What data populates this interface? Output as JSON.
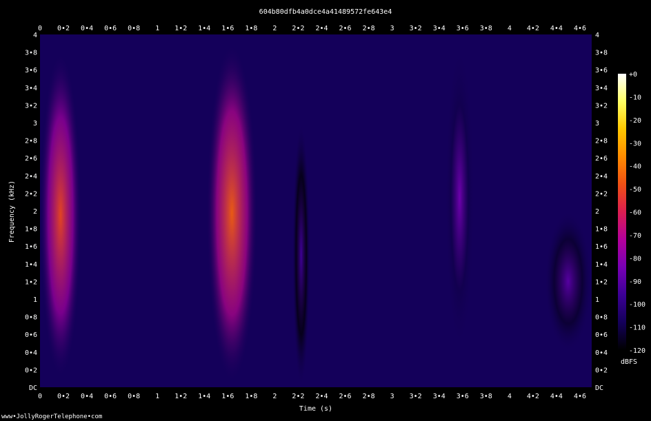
{
  "chart_data": {
    "type": "heatmap",
    "title": "604b80dfb4a0dce4a41489572fe643e4",
    "xlabel": "Time (s)",
    "ylabel": "Frequency (kHz)",
    "xlim": [
      0,
      4.7
    ],
    "ylim": [
      0,
      4
    ],
    "x_ticks": [
      "0",
      "0•2",
      "0•4",
      "0•6",
      "0•8",
      "1",
      "1•2",
      "1•4",
      "1•6",
      "1•8",
      "2",
      "2•2",
      "2•4",
      "2•6",
      "2•8",
      "3",
      "3•2",
      "3•4",
      "3•6",
      "3•8",
      "4",
      "4•2",
      "4•4",
      "4•6"
    ],
    "x_tick_values": [
      0,
      0.2,
      0.4,
      0.6,
      0.8,
      1,
      1.2,
      1.4,
      1.6,
      1.8,
      2,
      2.2,
      2.4,
      2.6,
      2.8,
      3,
      3.2,
      3.4,
      3.6,
      3.8,
      4,
      4.2,
      4.4,
      4.6
    ],
    "y_ticks": [
      "DC",
      "0•2",
      "0•4",
      "0•6",
      "0•8",
      "1",
      "1•2",
      "1•4",
      "1•6",
      "1•8",
      "2",
      "2•2",
      "2•4",
      "2•6",
      "2•8",
      "3",
      "3•2",
      "3•4",
      "3•6",
      "3•8",
      "4"
    ],
    "y_tick_values": [
      0,
      0.2,
      0.4,
      0.6,
      0.8,
      1,
      1.2,
      1.4,
      1.6,
      1.8,
      2,
      2.2,
      2.4,
      2.6,
      2.8,
      3,
      3.2,
      3.4,
      3.6,
      3.8,
      4
    ],
    "colorbar": {
      "label": "dBFS",
      "ticks": [
        "+0",
        "-10",
        "-20",
        "-30",
        "-40",
        "-50",
        "-60",
        "-70",
        "-80",
        "-90",
        "-100",
        "-110",
        "-120"
      ],
      "tick_values": [
        0,
        -10,
        -20,
        -30,
        -40,
        -50,
        -60,
        -70,
        -80,
        -90,
        -100,
        -110,
        -120
      ],
      "range": [
        -120,
        0
      ]
    },
    "colormap": [
      "#000000",
      "#14005a",
      "#3c0096",
      "#7800b4",
      "#b4009c",
      "#dc1e50",
      "#f05014",
      "#ff8c00",
      "#ffc800",
      "#ffff64",
      "#ffffff"
    ],
    "energy_regions": [
      {
        "t": [
          0.0,
          0.35
        ],
        "f": [
          0.1,
          3.8
        ],
        "level": -50
      },
      {
        "t": [
          1.42,
          1.85
        ],
        "f": [
          0.05,
          3.9
        ],
        "level": -45
      },
      {
        "t": [
          2.15,
          2.3
        ],
        "f": [
          0.0,
          3.0
        ],
        "level": -95
      },
      {
        "t": [
          3.45,
          3.7
        ],
        "f": [
          0.4,
          3.9
        ],
        "level": -85
      },
      {
        "t": [
          4.3,
          4.7
        ],
        "f": [
          0.4,
          2.0
        ],
        "level": -90
      }
    ]
  },
  "footer": "www•JollyRogerTelephone•com"
}
